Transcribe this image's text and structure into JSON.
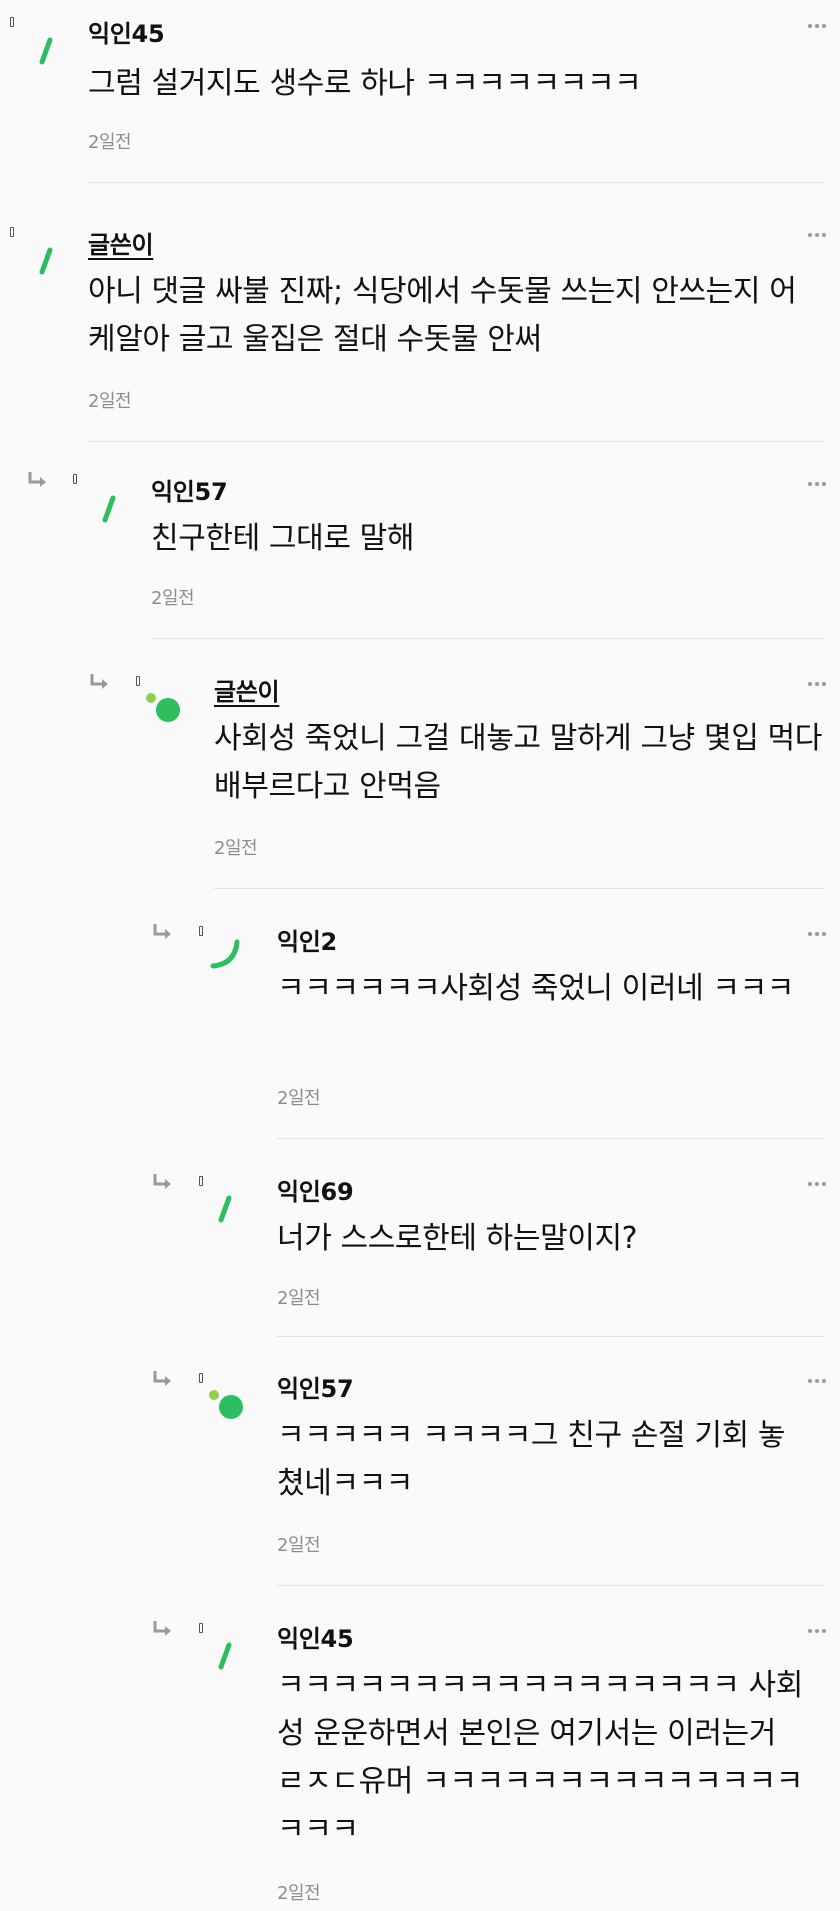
{
  "comments": [
    {
      "author": "익인45",
      "is_op": false,
      "level": 0,
      "avatar": "green-stroke",
      "body": "그럼 설거지도 생수로 하나 ㅋㅋㅋㅋㅋㅋㅋㅋ",
      "time": "2일전"
    },
    {
      "author": "글쓴이",
      "is_op": true,
      "level": 0,
      "avatar": "green-stroke",
      "body": "아니 댓글 싸불 진짜; 식당에서 수돗물 쓰는지 안쓰는지 어케알아 글고 울집은 절대 수돗물 안써",
      "time": "2일전"
    },
    {
      "author": "익인57",
      "is_op": false,
      "level": 1,
      "avatar": "green-stroke",
      "body": "친구한테 그대로 말해",
      "time": "2일전"
    },
    {
      "author": "글쓴이",
      "is_op": true,
      "level": 2,
      "avatar": "green-dots",
      "body": "사회성 죽었니 그걸 대놓고 말하게 그냥 몇입 먹다 배부르다고 안먹음",
      "time": "2일전"
    },
    {
      "author": "익인2",
      "is_op": false,
      "level": 3,
      "avatar": "green-arc",
      "body": "ㅋㅋㅋㅋㅋㅋ사회성 죽었니 이러네 ㅋㅋㅋ",
      "time": "2일전"
    },
    {
      "author": "익인69",
      "is_op": false,
      "level": 3,
      "avatar": "green-stroke",
      "body": "너가 스스로한테 하는말이지?",
      "time": "2일전"
    },
    {
      "author": "익인57",
      "is_op": false,
      "level": 3,
      "avatar": "green-dots",
      "body": "ㅋㅋㅋㅋㅋ ㅋㅋㅋㅋ그 친구 손절 기회 놓쳤네ㅋㅋㅋ",
      "time": "2일전"
    },
    {
      "author": "익인45",
      "is_op": false,
      "level": 3,
      "avatar": "green-stroke",
      "body": "ㅋㅋㅋㅋㅋㅋㅋㅋㅋㅋㅋㅋㅋㅋㅋㅋㅋ 사회성 운운하면서 본인은 여기서는 이러는거 ㄹㅈㄷ유머 ㅋㅋㅋㅋㅋㅋㅋㅋㅋㅋㅋㅋㅋㅋㅋㅋㅋ",
      "time": "2일전"
    }
  ],
  "icons": {
    "more": "more-horizontal-icon",
    "reply": "reply-arrow-icon",
    "marker": "bookmark-icon"
  },
  "colors": {
    "accent_green": "#2dbe60",
    "light_green": "#8fd14f",
    "timestamp": "#8d8d8d",
    "separator": "#e3e3e3"
  }
}
